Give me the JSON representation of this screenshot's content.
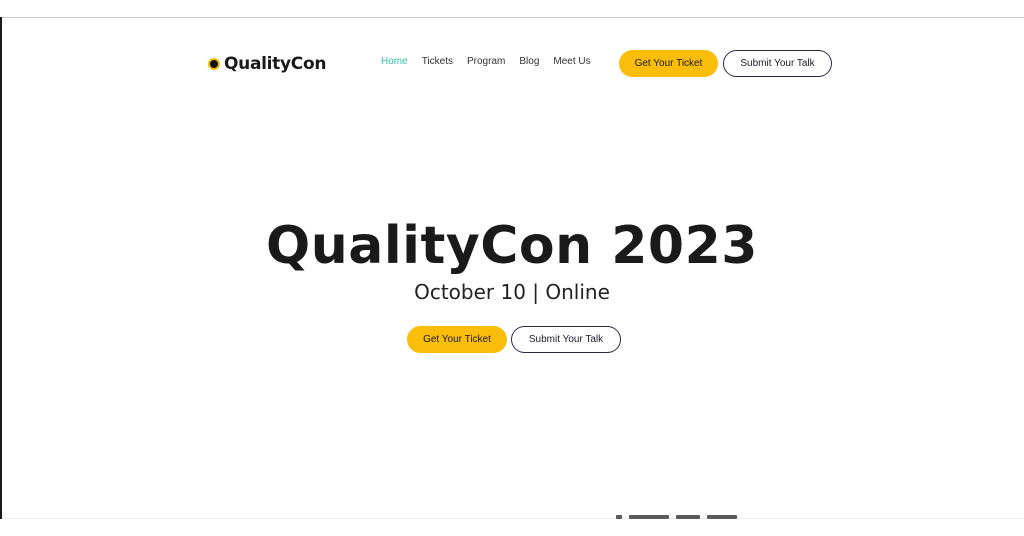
{
  "header": {
    "brand": "QualityCon",
    "nav": [
      "Home",
      "Tickets",
      "Program",
      "Blog",
      "Meet Us"
    ],
    "active_nav": "Home",
    "ticket_label": "Get Your Ticket",
    "talk_label": "Submit Your Talk"
  },
  "hero": {
    "title": "QualityCon 2023",
    "subtitle": "October 10 | Online",
    "ticket_label": "Get Your Ticket",
    "talk_label": "Submit Your Talk"
  },
  "colors": {
    "accent": "#f9bd0a",
    "nav_active": "#2fbfa7",
    "outline": "#2b2b45",
    "text": "#1a1a1a"
  }
}
